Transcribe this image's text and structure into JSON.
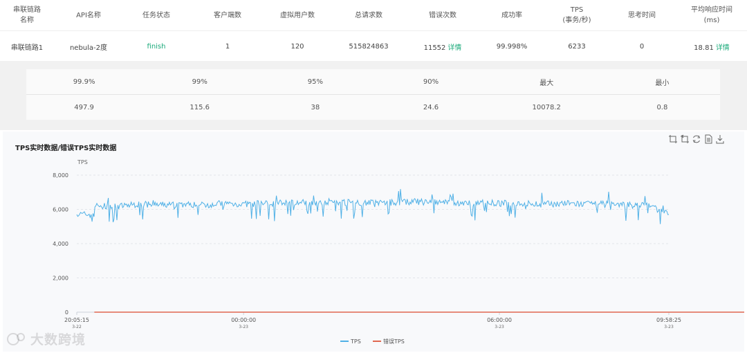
{
  "summary": {
    "headers": [
      "串联链路\n名称",
      "API名称",
      "任务状态",
      "客户端数",
      "虚拟用户数",
      "总请求数",
      "错误次数",
      "成功率",
      "TPS\n(事务/秒)",
      "思考时间",
      "平均响应时间\n(ms)"
    ],
    "row": {
      "chain": "串联链路1",
      "api": "nebula-2度",
      "status": "finish",
      "clients": "1",
      "vusers": "120",
      "total_requests": "515824863",
      "errors": "11552",
      "errors_link": "详情",
      "success_rate": "99.998%",
      "tps": "6233",
      "think_time": "0",
      "avg_rt": "18.81",
      "avg_rt_link": "详情"
    }
  },
  "percentiles": {
    "headers": [
      "99.9%",
      "99%",
      "95%",
      "90%",
      "最大",
      "最小"
    ],
    "values": [
      "497.9",
      "115.6",
      "38",
      "24.6",
      "10078.2",
      "0.8"
    ]
  },
  "watermark": "大数跨境",
  "colors": {
    "tps": "#4fb0e6",
    "error_tps": "#e0674f",
    "accent": "#1aaa7a"
  },
  "toolbox_icons": [
    "zoom-icon",
    "zoom-reset-icon",
    "restore-icon",
    "data-view-icon",
    "download-icon"
  ],
  "chart_data": {
    "type": "line",
    "title": "TPS实时数据/错误TPS实时数据",
    "ylabel": "TPS",
    "ylim": [
      0,
      8000
    ],
    "yticks": [
      "0",
      "2,000",
      "4,000",
      "6,000",
      "8,000"
    ],
    "xticks": [
      {
        "time": "20:05:15",
        "date": "3-22"
      },
      {
        "time": "00:00:00",
        "date": "3-23"
      },
      {
        "time": "06:00:00",
        "date": "3-23"
      },
      {
        "time": "09:58:25",
        "date": "3-23"
      }
    ],
    "x_range": [
      "3-22 20:05:15",
      "3-23 09:58:25"
    ],
    "grid": true,
    "legend_position": "bottom",
    "series": [
      {
        "name": "TPS",
        "x": [
          "20:05",
          "20:30",
          "21:00",
          "21:30",
          "22:00",
          "22:30",
          "23:00",
          "23:30",
          "00:00",
          "00:30",
          "01:00",
          "01:30",
          "02:00",
          "02:30",
          "03:00",
          "03:30",
          "04:00",
          "04:30",
          "05:00",
          "05:30",
          "06:00",
          "06:30",
          "07:00",
          "07:30",
          "08:00",
          "08:30",
          "09:00",
          "09:30",
          "09:58"
        ],
        "values": [
          5900,
          6200,
          6150,
          6300,
          6250,
          6300,
          6250,
          6350,
          6300,
          6350,
          6400,
          6400,
          6450,
          6400,
          6400,
          6400,
          6450,
          6400,
          6350,
          6400,
          6350,
          6350,
          6300,
          6350,
          6300,
          6300,
          6250,
          6250,
          5700
        ]
      },
      {
        "name": "错误TPS",
        "values": [
          0,
          0,
          0,
          0,
          0,
          0,
          0,
          0,
          0,
          0,
          0,
          0,
          0,
          0,
          0,
          0,
          0,
          0,
          0,
          0,
          0,
          0,
          0,
          0,
          0,
          0,
          0,
          0,
          0
        ]
      }
    ]
  }
}
